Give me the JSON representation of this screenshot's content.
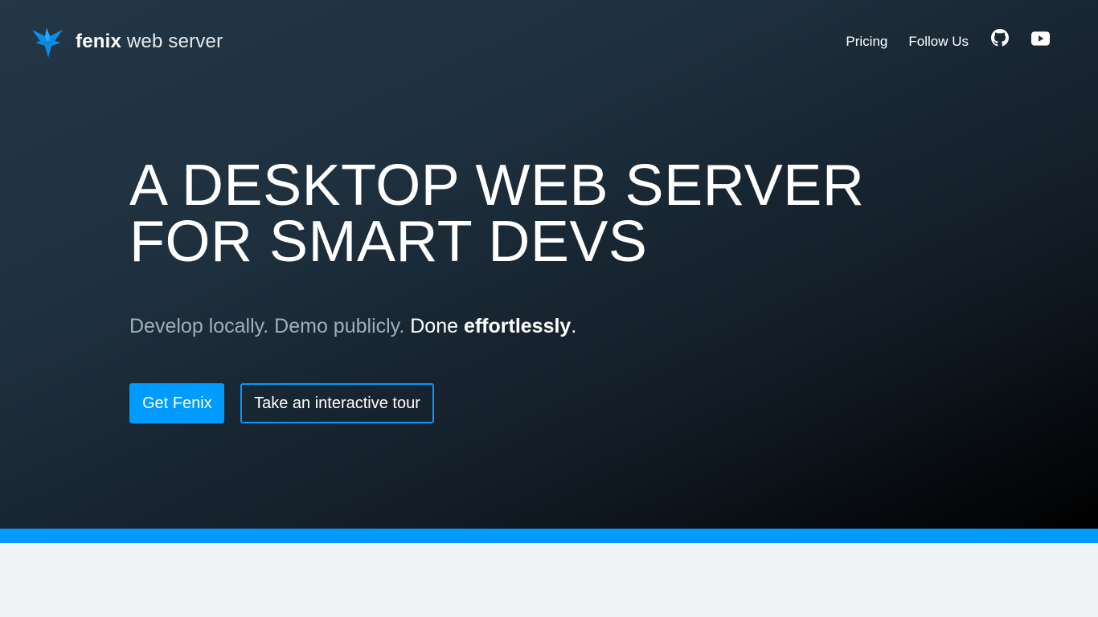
{
  "header": {
    "logo_bold": "fenix",
    "logo_light": "web server",
    "nav": [
      {
        "label": "Pricing"
      },
      {
        "label": "Follow Us"
      }
    ],
    "icons": [
      "github-icon",
      "youtube-icon"
    ]
  },
  "hero": {
    "title_line1": "A DESKTOP WEB SERVER",
    "title_line2": "FOR SMART DEVS",
    "tagline_part1": "Develop locally. Demo publicly.",
    "tagline_done": "Done",
    "tagline_bold": "effortlessly",
    "tagline_end": ".",
    "primary_button": "Get Fenix",
    "secondary_button": "Take an interactive tour"
  },
  "colors": {
    "accent": "#009bff",
    "hero_top": "#243747",
    "hero_bottom": "#000000",
    "below_bg": "#eef2f5"
  }
}
